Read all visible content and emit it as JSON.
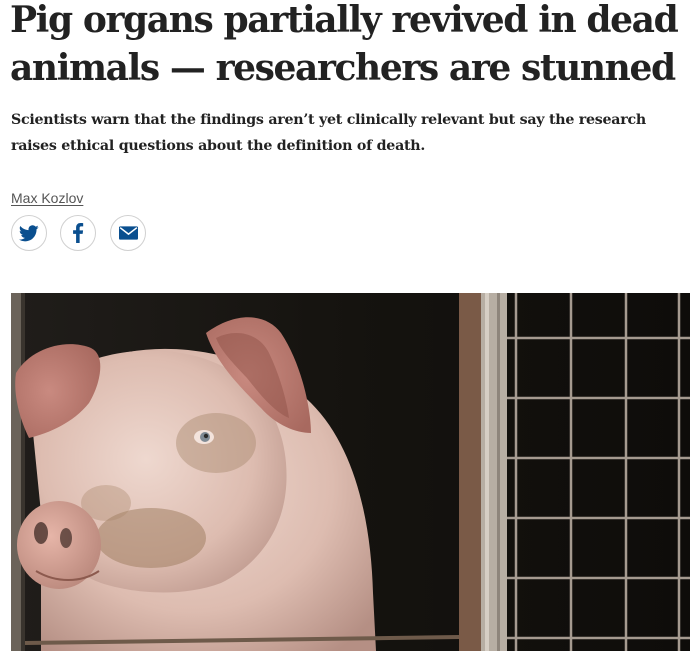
{
  "article": {
    "headline": "Pig organs partially revived in dead animals — researchers are stunned",
    "standfirst": "Scientists warn that the findings aren’t yet clinically relevant but say the research raises ethical questions about the definition of death.",
    "author": "Max Kozlov"
  },
  "share": {
    "icons": [
      "twitter-icon",
      "facebook-icon",
      "email-icon"
    ],
    "accent_color": "#0a4f8f"
  },
  "hero_image": {
    "subject": "pig-behind-cage-photo"
  }
}
